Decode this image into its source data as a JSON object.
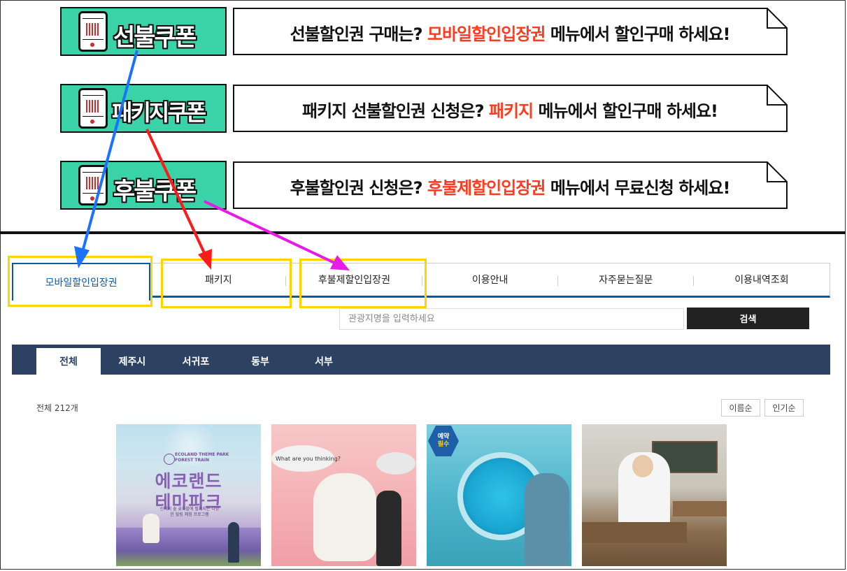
{
  "coupons": [
    {
      "title": "선불쿠폰",
      "text_before": "선불할인권 구매는? ",
      "highlight": "모바일할인입장권",
      "text_after": " 메뉴에서 할인구매 하세요!"
    },
    {
      "title": "패키지쿠폰",
      "text_before": "패키지 선불할인권 신청은? ",
      "highlight": "패키지",
      "text_after": " 메뉴에서 할인구매 하세요!"
    },
    {
      "title": "후불쿠폰",
      "text_before": "후불할인권 신청은? ",
      "highlight": "후불제할인입장권",
      "text_after": " 메뉴에서 무료신청 하세요!"
    }
  ],
  "tabs": [
    "모바일할인입장권",
    "패키지",
    "후불제할인입장권",
    "이용안내",
    "자주묻는질문",
    "이용내역조회"
  ],
  "search": {
    "placeholder": "관광지명을 입력하세요",
    "button": "검색"
  },
  "regions": [
    "전체",
    "제주시",
    "서귀포",
    "동부",
    "서부"
  ],
  "count_label": "전체 212개",
  "sort": [
    "이름순",
    "인기순"
  ],
  "thumbs": [
    {
      "logo": "ECOLAND THEME PARK FOREST TRAIN",
      "title1": "에코랜드",
      "title2": "테마파크",
      "caption": "신비의 숲 곶자왈에 펼쳐지는 다양한 힐링 체험 프로그램"
    },
    {
      "bubble": "What are you thinking?"
    },
    {
      "badge1": "예약",
      "badge2": "필수"
    },
    {}
  ],
  "colors": {
    "coupon_green": "#3ad3a8",
    "highlight_red": "#ff3b1f",
    "tab_blue": "#0b5aa0",
    "region_bar": "#2d4263",
    "annotation_yellow": "#ffd400",
    "arrow_blue": "#1a73ff",
    "arrow_red": "#ff1a1a",
    "arrow_magenta": "#e81ae8"
  }
}
